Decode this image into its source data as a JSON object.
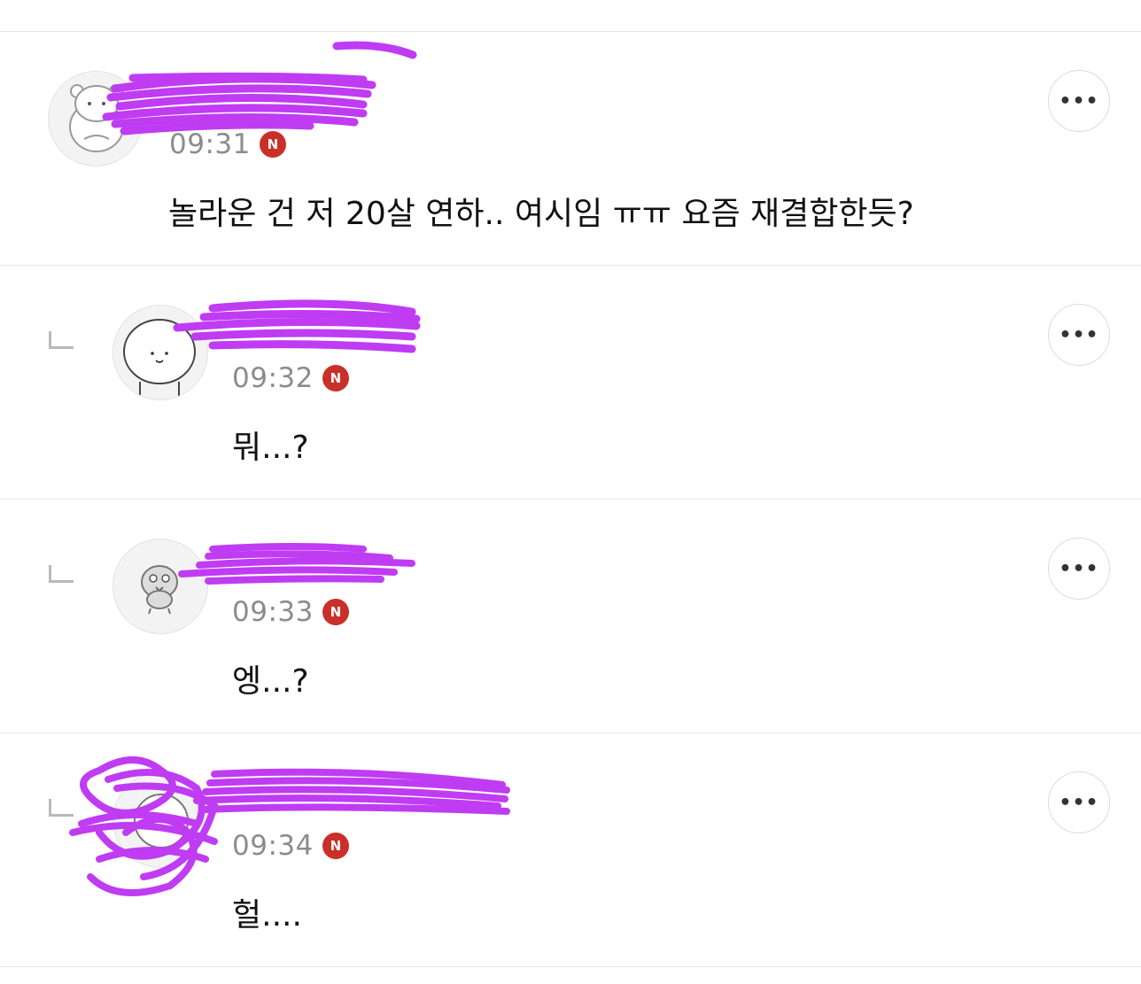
{
  "comments": [
    {
      "is_reply": false,
      "author": "",
      "time": "09:31",
      "badge": "N",
      "text": "놀라운 건 저 20살 연하.. 여시임 ㅠㅠ 요즘 재결합한듯?",
      "avatar_icon": "hamster-character-icon",
      "more_label": "•••"
    },
    {
      "is_reply": true,
      "author": "",
      "time": "09:32",
      "badge": "N",
      "text": "뭐...?",
      "avatar_icon": "round-face-character-icon",
      "more_label": "•••"
    },
    {
      "is_reply": true,
      "author": "",
      "time": "09:33",
      "badge": "N",
      "text": "엥...?",
      "avatar_icon": "bird-character-icon",
      "more_label": "•••"
    },
    {
      "is_reply": true,
      "author": "",
      "time": "09:34",
      "badge": "N",
      "text": "헐....",
      "avatar_icon": "character-icon",
      "more_label": "•••"
    }
  ],
  "colors": {
    "badge": "#c9302a",
    "scribble": "#bf3cf2",
    "divider": "#e6e6e6",
    "time": "#8c8c8c"
  }
}
